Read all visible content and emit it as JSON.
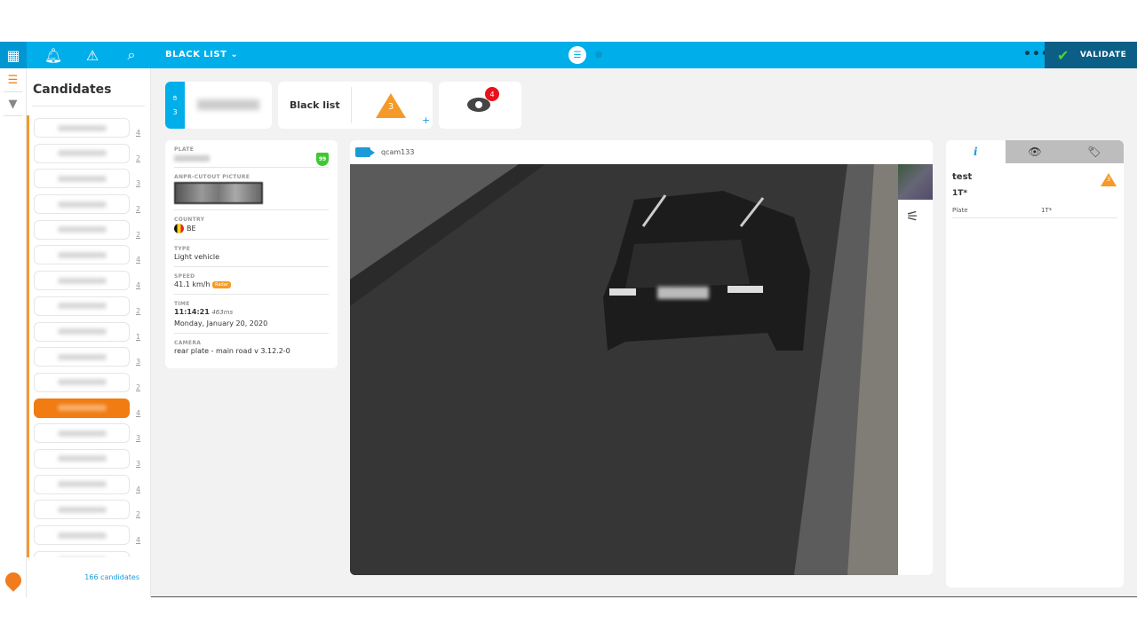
{
  "topbar": {
    "list_title": "BLACK LIST",
    "more": "•••",
    "validate_label": "VALIDATE",
    "accent": "#00aeea"
  },
  "candidates": {
    "title": "Candidates",
    "total_label": "166 candidates",
    "counts": [
      "4",
      "2",
      "3",
      "2",
      "2",
      "4",
      "4",
      "2",
      "1",
      "3",
      "2",
      "4",
      "3",
      "3",
      "4",
      "2",
      "4"
    ],
    "selected_index": 11
  },
  "summary": {
    "hand_count": "3",
    "list_name": "Black list",
    "alert_count": "3",
    "add": "+",
    "views_badge": "4"
  },
  "details": {
    "plate_label": "PLATE",
    "score": "99",
    "cutout_label": "ANPR-CUTOUT PICTURE",
    "country_label": "COUNTRY",
    "country": "BE",
    "type_label": "TYPE",
    "type": "Light vehicle",
    "speed_label": "SPEED",
    "speed": "41.1 km/h",
    "speed_source": "Radar",
    "time_label": "TIME",
    "time": "11:14:21",
    "time_ms": "463ms",
    "date": "Monday, January 20, 2020",
    "camera_label": "CAMERA",
    "camera": "rear plate - main road v 3.12.2-0"
  },
  "camera_view": {
    "name": "qcam133"
  },
  "info_panel": {
    "tabs": [
      "i",
      "eye",
      "tag"
    ],
    "list": "test",
    "level": "3",
    "plate_pattern": "1T*",
    "field_label": "Plate",
    "field_value": "1T*"
  }
}
